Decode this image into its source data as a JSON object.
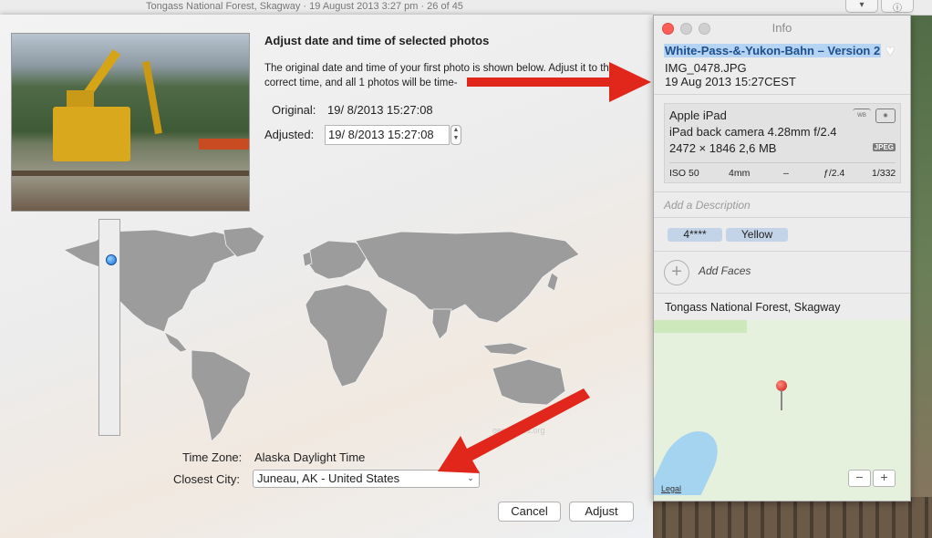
{
  "window": {
    "title": "Tongass National Forest, Skagway  ·  19 August 2013 3:27 pm  ·  26 of 45",
    "share_icon": "chevron-down-icon",
    "info_icon": "info-icon"
  },
  "dialog": {
    "heading": "Adjust date and time of selected photos",
    "description": "The original date and time of your first photo is shown below. Adjust it to the correct time, and all 1 photos will be time-",
    "original_label": "Original:",
    "original_value": "19/  8/2013 15:27:08",
    "adjusted_label": "Adjusted:",
    "adjusted_value": "19/  8/2013 15:27:08",
    "timezone_label": "Time Zone:",
    "timezone_value": "Alaska Daylight Time",
    "city_label": "Closest City:",
    "city_value": "Juneau, AK - United States",
    "map_credit": "geonames.org",
    "cancel_label": "Cancel",
    "adjust_label": "Adjust"
  },
  "info_panel": {
    "title": "Info",
    "photo_title": "White-Pass-&-Yukon-Bahn – Version 2",
    "filename": "IMG_0478.JPG",
    "datetime": "19 Aug 2013    15:27CEST",
    "camera": "Apple iPad",
    "lens": "iPad back camera 4.28mm f/2.4",
    "dimensions": "2472 × 1846    2,6 MB",
    "format_badge": "JPEG",
    "exif": {
      "iso": "ISO 50",
      "focal": "4mm",
      "ev": "–",
      "aperture": "ƒ/2.4",
      "shutter": "1/332"
    },
    "description_placeholder": "Add a Description",
    "keywords": [
      "4****",
      "Yellow"
    ],
    "add_faces_label": "Add Faces",
    "place": "Tongass National Forest, Skagway",
    "legal": "Legal",
    "zoom_out": "−",
    "zoom_in": "+"
  },
  "colors": {
    "annotation_arrow": "#e1261c",
    "selection": "#b5d3f2",
    "map_pin": "#cc1a10"
  }
}
